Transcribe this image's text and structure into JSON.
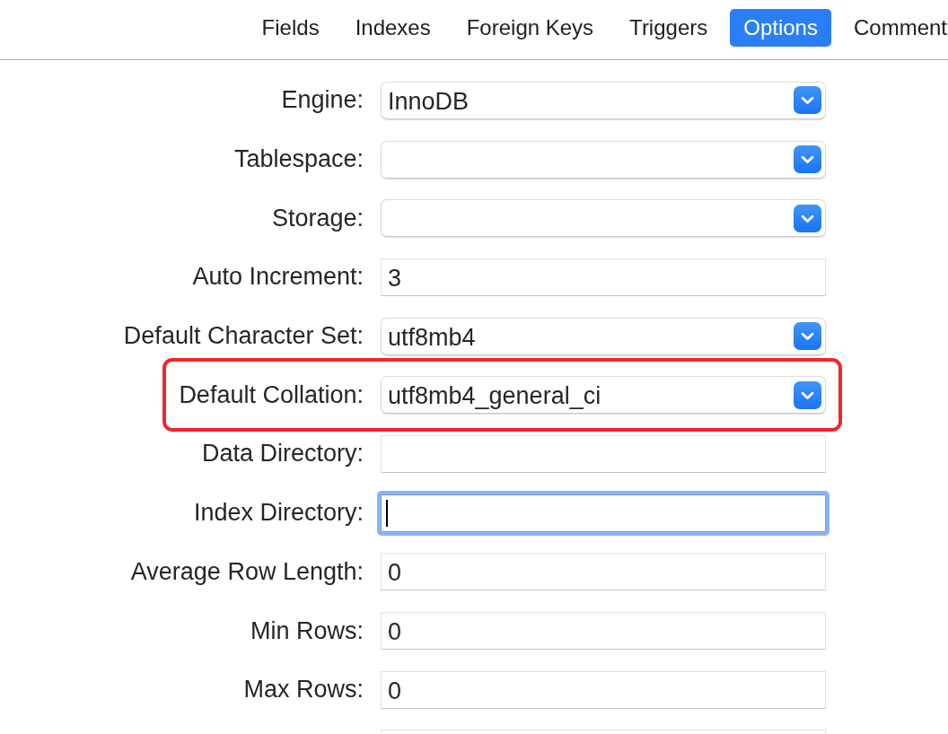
{
  "tabs": [
    {
      "label": "Fields",
      "selected": false
    },
    {
      "label": "Indexes",
      "selected": false
    },
    {
      "label": "Foreign Keys",
      "selected": false
    },
    {
      "label": "Triggers",
      "selected": false
    },
    {
      "label": "Options",
      "selected": true
    },
    {
      "label": "Comment",
      "selected": false
    }
  ],
  "options": [
    {
      "label": "Engine:",
      "kind": "dropdown",
      "value": "InnoDB",
      "highlighted": false,
      "focused": false
    },
    {
      "label": "Tablespace:",
      "kind": "dropdown",
      "highlighted": false,
      "focused": false
    },
    {
      "label": "Storage:",
      "kind": "dropdown",
      "highlighted": false,
      "focused": false
    },
    {
      "label": "Auto Increment:",
      "kind": "text",
      "value": "3",
      "highlighted": false,
      "focused": false
    },
    {
      "label": "Default Character Set:",
      "kind": "dropdown",
      "value": "utf8mb4",
      "highlighted": false,
      "focused": false
    },
    {
      "label": "Default Collation:",
      "kind": "dropdown",
      "value": "utf8mb4_general_ci",
      "highlighted": true,
      "focused": false
    },
    {
      "label": "Data Directory:",
      "kind": "text",
      "highlighted": false,
      "focused": false
    },
    {
      "label": "Index Directory:",
      "kind": "text",
      "highlighted": false,
      "focused": true
    },
    {
      "label": "Average Row Length:",
      "kind": "text",
      "value": "0",
      "highlighted": false,
      "focused": false
    },
    {
      "label": "Min Rows:",
      "kind": "text",
      "value": "0",
      "highlighted": false,
      "focused": false
    },
    {
      "label": "Max Rows:",
      "kind": "text",
      "value": "0",
      "highlighted": false,
      "focused": false
    },
    {
      "kind": "text",
      "highlighted": false,
      "focused": false
    }
  ]
}
